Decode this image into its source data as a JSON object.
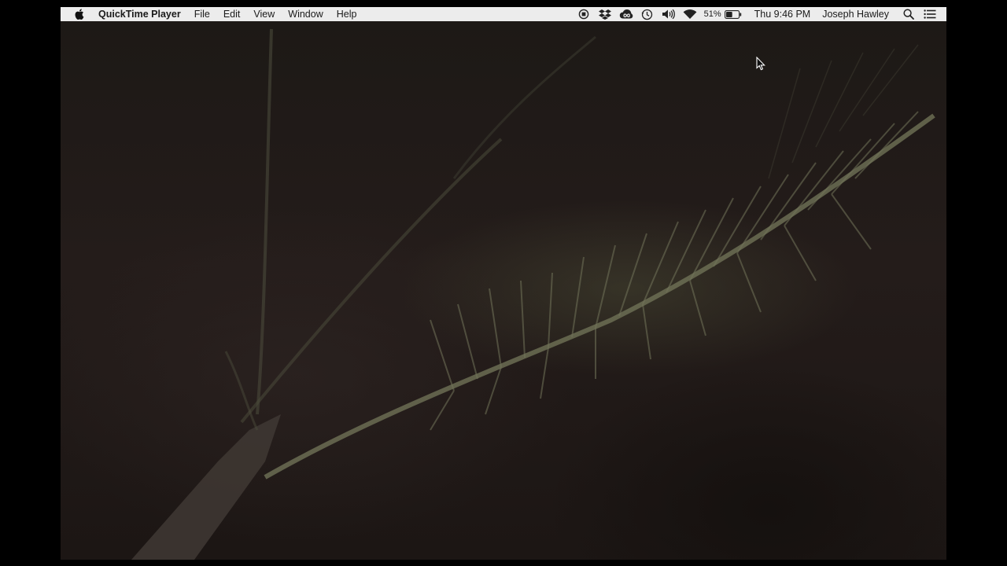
{
  "menubar": {
    "app_name": "QuickTime Player",
    "menus": [
      "File",
      "Edit",
      "View",
      "Window",
      "Help"
    ],
    "status_icons": [
      "screen-record-icon",
      "dropbox-icon",
      "creative-cloud-icon",
      "time-machine-icon",
      "volume-icon",
      "wifi-icon"
    ],
    "battery_percent": "51%",
    "battery_level": 0.51,
    "clock": "Thu 9:46 PM",
    "user_name": "Joseph Hawley"
  },
  "video": {
    "description_icon": "video-frame",
    "colors": {
      "background": "#1b1614",
      "frond": "#6f7256",
      "trunk": "#4a4540"
    }
  }
}
